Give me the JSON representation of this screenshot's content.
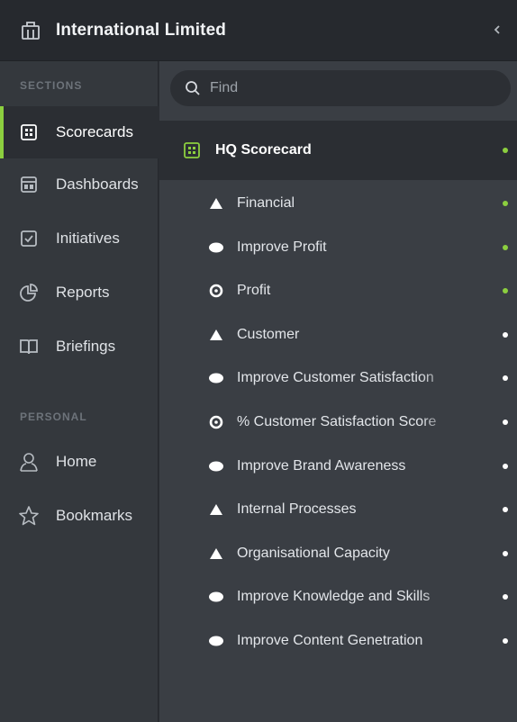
{
  "header": {
    "title": "International Limited",
    "collapse_icon": "chevron-left-icon"
  },
  "sidebar": {
    "sections_label": "SECTIONS",
    "personal_label": "PERSONAL",
    "items": [
      {
        "label": "Scorecards",
        "icon": "scorecard-icon",
        "active": true
      },
      {
        "label": "Dashboards",
        "icon": "dashboard-icon"
      },
      {
        "label": "Initiatives",
        "icon": "checkbox-icon"
      },
      {
        "label": "Reports",
        "icon": "pie-chart-icon"
      },
      {
        "label": "Briefings",
        "icon": "book-icon"
      }
    ],
    "personal_items": [
      {
        "label": "Home",
        "icon": "user-icon"
      },
      {
        "label": "Bookmarks",
        "icon": "star-icon"
      }
    ]
  },
  "search": {
    "placeholder": "Find",
    "value": ""
  },
  "scorecard": {
    "title": "HQ Scorecard",
    "status_color": "#8ccf3f"
  },
  "tree": [
    {
      "label": "Financial",
      "kind": "perspective",
      "status_color": "#8ccf3f"
    },
    {
      "label": "Improve Profit",
      "kind": "objective",
      "status_color": "#8ccf3f"
    },
    {
      "label": "Profit",
      "kind": "measure",
      "status_color": "#8ccf3f"
    },
    {
      "label": "Customer",
      "kind": "perspective",
      "status_color": "#ffffff"
    },
    {
      "label": "Improve Customer Satisfaction",
      "kind": "objective",
      "status_color": "#ffffff"
    },
    {
      "label": "% Customer Satisfaction Score",
      "kind": "measure",
      "status_color": "#ffffff"
    },
    {
      "label": "Improve Brand Awareness",
      "kind": "objective",
      "status_color": "#ffffff"
    },
    {
      "label": "Internal Processes",
      "kind": "perspective",
      "status_color": "#ffffff"
    },
    {
      "label": "Organisational Capacity",
      "kind": "perspective",
      "status_color": "#ffffff"
    },
    {
      "label": "Improve Knowledge and Skills",
      "kind": "objective",
      "status_color": "#ffffff"
    },
    {
      "label": "Improve Content Genetration",
      "kind": "objective",
      "status_color": "#ffffff"
    }
  ],
  "colors": {
    "accent": "#8ccf3f",
    "neutral_status": "#ffffff"
  }
}
